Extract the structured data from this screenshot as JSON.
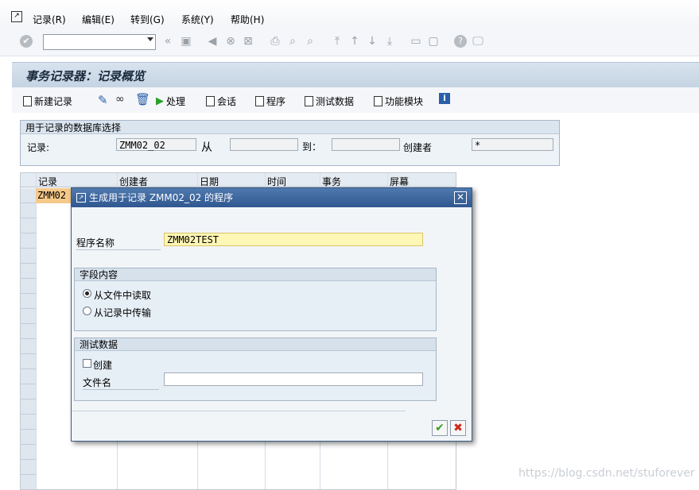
{
  "menu": {
    "items": [
      "记录(R)",
      "编辑(E)",
      "转到(G)",
      "系统(Y)",
      "帮助(H)"
    ]
  },
  "toolbar": {
    "command_value": ""
  },
  "screen": {
    "title": "事务记录器：记录概览"
  },
  "app_toolbar": {
    "new_record": "新建记录",
    "process": "处理",
    "session": "会话",
    "program": "程序",
    "test_data": "测试数据",
    "function_module": "功能模块"
  },
  "selection": {
    "header": "用于记录的数据库选择",
    "record_label": "记录:",
    "record_value": "ZMM02_02",
    "from_label": "从",
    "from_value": "",
    "to_label": "到：",
    "to_value": "",
    "creator_label": "创建者",
    "creator_value": "*"
  },
  "grid": {
    "columns": [
      "记录",
      "创建者",
      "日期",
      "时间",
      "事务",
      "屏幕"
    ],
    "first_row_record": "ZMM02"
  },
  "dialog": {
    "title": "生成用于记录 ZMM02_02 的程序",
    "program_name_label": "程序名称",
    "program_name_value": "ZMM02TEST",
    "field_content_header": "字段内容",
    "radio_read_file": "从文件中读取",
    "radio_transfer": "从记录中传输",
    "test_data_header": "测试数据",
    "create_label": "创建",
    "filename_label": "文件名",
    "filename_value": ""
  },
  "watermark": "https://blog.csdn.net/stuforever",
  "colors": {
    "title_bar": "#c4d3e2",
    "dialog_title": "#2f5790",
    "input_highlight": "#fff7b5",
    "grid_selected": "#f5c98a"
  }
}
